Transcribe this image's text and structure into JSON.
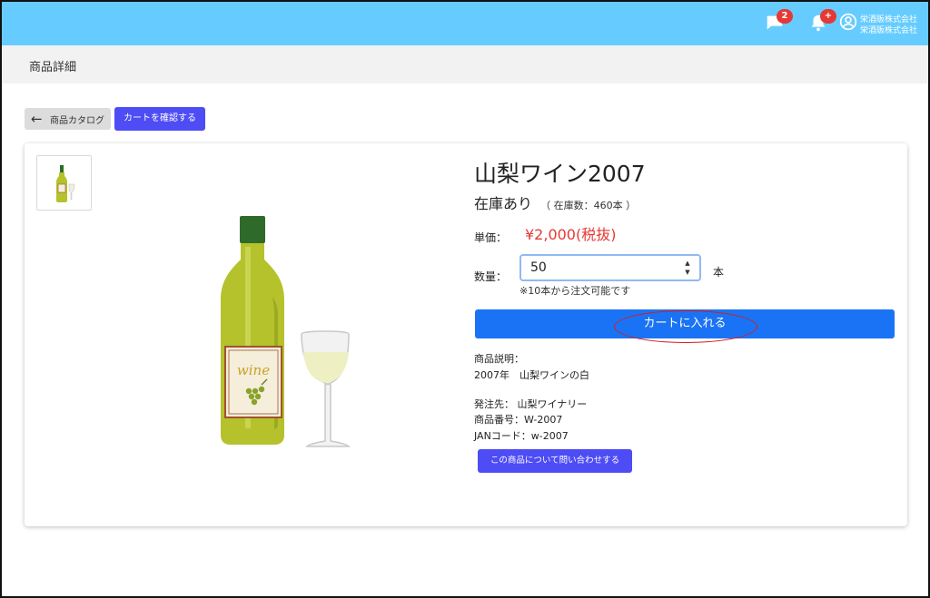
{
  "header": {
    "chat_badge": "2",
    "notification_badge": "+",
    "company_line1": "栄酒販株式会社",
    "company_line2": "栄酒販株式会社",
    "icons": [
      "chat-icon",
      "bell-icon",
      "account-icon"
    ],
    "bar_color": "#66ccff"
  },
  "subheader": {
    "title": "商品詳細"
  },
  "toolbar": {
    "back_label": "商品カタログ",
    "cart_check_label": "カートを確認する"
  },
  "product": {
    "name": "山梨ワイン2007",
    "stock_status": "在庫あり",
    "stock_count": "（ 在庫数：460本 ）",
    "price_label": "単価：",
    "price": "¥2,000(税抜)",
    "quantity_label": "数量：",
    "quantity_value": "50",
    "quantity_unit": "本",
    "quantity_note": "※10本から注文可能です",
    "add_to_cart_label": "カートに入れる",
    "description_label": "商品説明：",
    "description": "2007年　山梨ワインの白",
    "supplier": "発注先：  山梨ワイナリー",
    "product_number": "商品番号：W-2007",
    "jan_code": "JANコード：w-2007",
    "inquiry_label": "この商品について問い合わせする",
    "image_label": "wine"
  },
  "colors": {
    "primary_button": "#1a73f5",
    "secondary_button": "#4e4cf5",
    "price": "#e53935",
    "highlight_ellipse": "#d91c1c"
  }
}
